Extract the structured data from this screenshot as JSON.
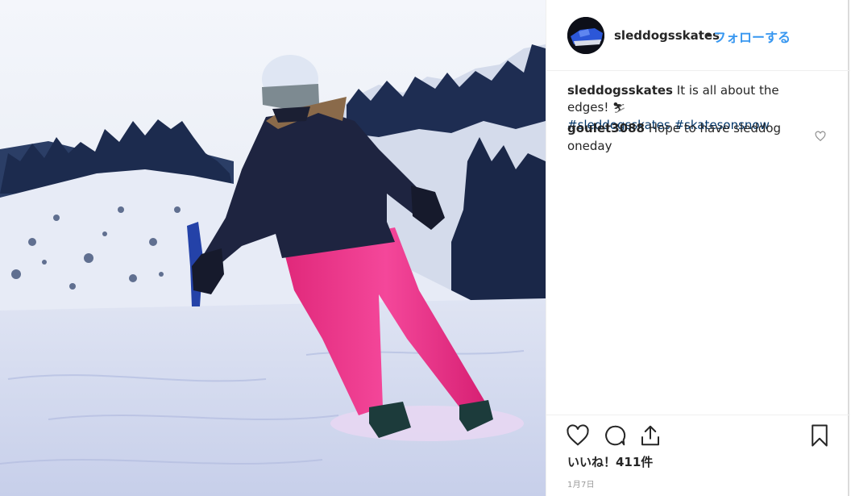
{
  "post": {
    "username": "sleddogsskates",
    "separator": "•",
    "follow_label": "フォローする",
    "caption": {
      "username": "sleddogsskates",
      "text": "It is all about the edges! ",
      "emoji": "⛷",
      "hashtags": [
        "#sleddogsskates",
        "#skatesonsnow"
      ]
    },
    "comments": [
      {
        "username": "goulet3088",
        "text": "Hope to have sleddog oneday"
      }
    ],
    "likes_label": "いいね！411件",
    "date_label": "1月7日"
  },
  "icons": {
    "like": "heart-outline-icon",
    "comment": "comment-bubble-icon",
    "share": "share-icon",
    "save": "bookmark-icon",
    "comment_like": "small-heart-icon"
  },
  "colors": {
    "link": "#3897f0",
    "hashtag": "#003569",
    "text": "#262626",
    "muted": "#999999",
    "divider": "#efefef"
  }
}
